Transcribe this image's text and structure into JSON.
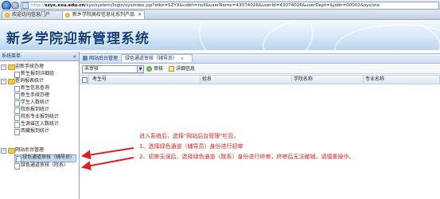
{
  "browser": {
    "url_prefix": "http://",
    "url_domain": "szyx.xxu.edu.cn",
    "url_rest": "/sys/system/login/sysindex.jsp?xtbz=SZYX&cdbh=null&userName=43074026&userId=43074026&userDept=&jsbh=00002&sys/sta",
    "tabs": [
      {
        "label": "欢迎访问信息门户"
      },
      {
        "label": "新乡学院高校信息化系列产品"
      }
    ]
  },
  "banner": {
    "title": "新乡学院迎新管理系统"
  },
  "left_panel": {
    "header": "系统菜单",
    "collapse": "«",
    "tree": [
      {
        "label": "迎新手续办理",
        "toggle": "−"
      },
      {
        "label": "新生报到详细组"
      },
      {
        "label": "查询报表统计",
        "toggle": "−"
      },
      {
        "label": "新生信息查询"
      },
      {
        "label": "新生手续办理"
      },
      {
        "label": "学生入数统计"
      },
      {
        "label": "院系报到统计"
      },
      {
        "label": "院系专业报到统计"
      },
      {
        "label": "生源省区入数统计"
      },
      {
        "label": "西藏报到统计"
      },
      {
        "label": "网站后台管理",
        "toggle": "−"
      },
      {
        "label": "绿色通道审核（辅导员）"
      },
      {
        "label": "绿色通道审核（院系）"
      }
    ]
  },
  "main": {
    "crumbs": {
      "home": "网站后台管理",
      "tab": "绿色通道审核（辅导员）",
      "close": "×"
    },
    "toolbar": {
      "filter_value": "未审核",
      "filter_arrow": "▼",
      "approve": "审核",
      "details": "详细信息"
    },
    "columns": [
      "考生号",
      "姓名",
      "学院名称",
      "专业名称"
    ]
  },
  "annotation": {
    "line1": "进入系统后，选择\"网站后台管理\"栏目，",
    "line2": "1、选择绿色通道（辅导员）身份进行初审",
    "line3": "2、初审无误后，选择绿色通道（院系）身份进行终审，终审后无法撤销，请慎重操作。"
  },
  "colors": {
    "banner_title": "#0f3d7c",
    "annotation": "#e02020",
    "tree_selected": "#c5dbf5"
  }
}
